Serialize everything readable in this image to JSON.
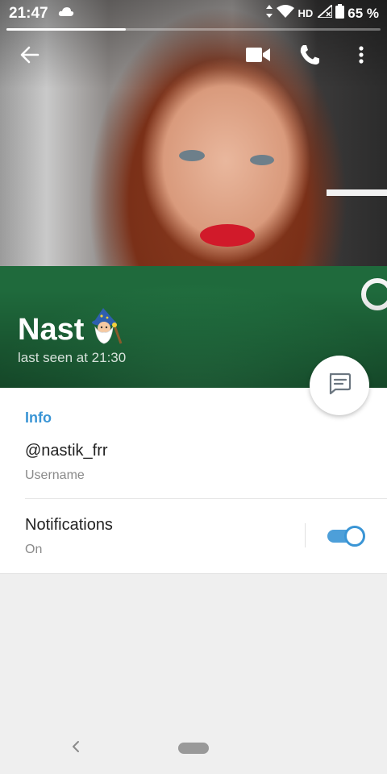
{
  "status_bar": {
    "time": "21:47",
    "network": "HD",
    "battery": "65 %"
  },
  "stories_progress": 0.32,
  "toolbar": {
    "back_icon": "arrow-left-icon",
    "video_icon": "video-camera-icon",
    "call_icon": "phone-icon",
    "more_icon": "more-vertical-icon"
  },
  "profile": {
    "name": "Nast",
    "emoji": "🧙‍♂️",
    "last_seen": "last seen at 21:30"
  },
  "info": {
    "header": "Info",
    "username": "@nastik_frr",
    "username_label": "Username",
    "notifications_title": "Notifications",
    "notifications_value": "On",
    "notifications_enabled": true
  },
  "colors": {
    "accent": "#3a95d5",
    "panel_bg": "#ffffff",
    "screen_bg": "#efefef"
  }
}
